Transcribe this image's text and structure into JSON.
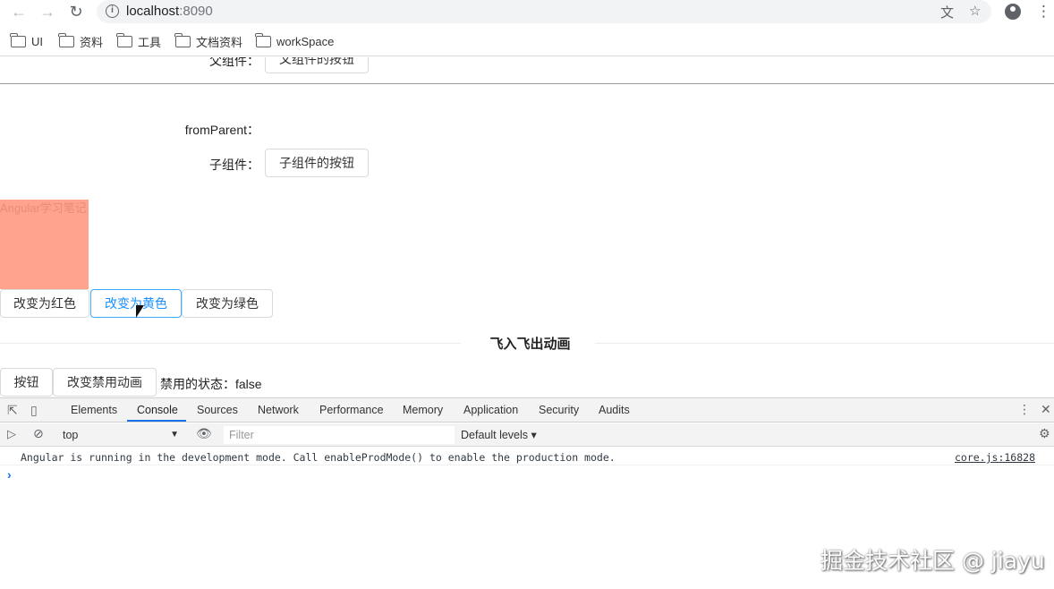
{
  "browser": {
    "url_host": "localhost",
    "url_port": ":8090",
    "bookmarks": [
      "UI",
      "资料",
      "工具",
      "文档资料",
      "workSpace"
    ]
  },
  "page": {
    "parent_label": "父组件：",
    "parent_button": "父组件的按钮",
    "from_parent_label": "fromParent：",
    "child_label": "子组件：",
    "child_button": "子组件的按钮",
    "box_text": "Angular学习笔记",
    "box_color": "#ffa38f",
    "color_buttons": [
      "改变为红色",
      "改变为黄色",
      "改变为绿色"
    ],
    "section_title": "飞入飞出动画",
    "anim_button": "按钮",
    "toggle_disable_button": "改变禁用动画",
    "disabled_state_label": "禁用的状态：",
    "disabled_state_value": "false"
  },
  "devtools": {
    "tabs": [
      "Elements",
      "Console",
      "Sources",
      "Network",
      "Performance",
      "Memory",
      "Application",
      "Security",
      "Audits"
    ],
    "active_tab": "Console",
    "context": "top",
    "filter_placeholder": "Filter",
    "levels": "Default levels ▾",
    "console_message": "Angular is running in the development mode. Call enableProdMode() to enable the production mode.",
    "console_source": "core.js:16828",
    "prompt": "›"
  },
  "watermark": "掘金技术社区 @ jiayu"
}
